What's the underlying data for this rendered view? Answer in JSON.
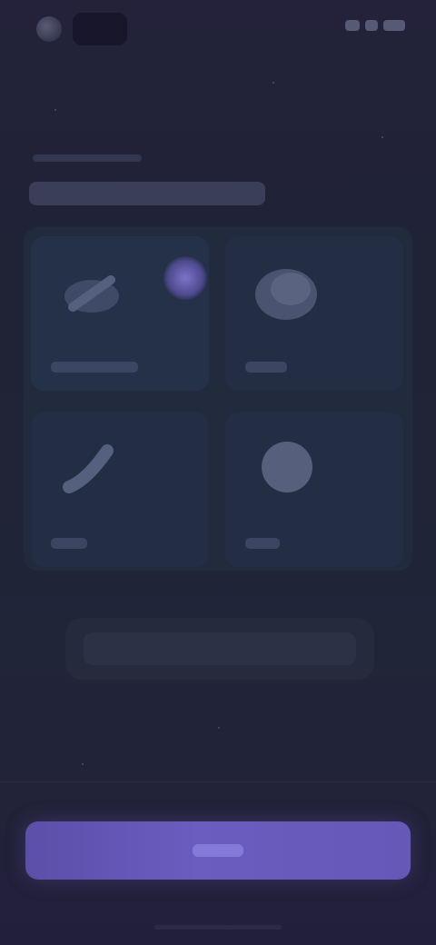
{
  "status_bar": {
    "app_logo_icon": "app-logo-icon",
    "status_icons": [
      "signal-icon",
      "wifi-icon",
      "battery-icon"
    ]
  },
  "header": {
    "breadcrumb": "",
    "title": ""
  },
  "options": [
    {
      "icon": "wand-icon",
      "label": "",
      "selected": true
    },
    {
      "icon": "cloud-icon",
      "label": "",
      "selected": false
    },
    {
      "icon": "brush-icon",
      "label": "",
      "selected": false
    },
    {
      "icon": "circle-icon",
      "label": "",
      "selected": false
    }
  ],
  "secondary_button": {
    "label": ""
  },
  "primary_button": {
    "label": ""
  },
  "colors": {
    "accent": "#6b5cc0",
    "background": "#1f2233",
    "card": "#232d44"
  }
}
